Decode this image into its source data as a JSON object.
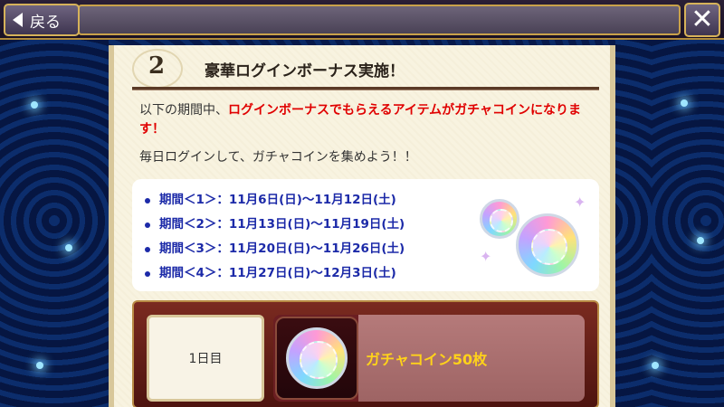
{
  "topbar": {
    "back_label": "戻る",
    "close_label": "✕"
  },
  "section": {
    "number": "2",
    "title": "豪華ログインボーナス実施！"
  },
  "intro": {
    "prefix": "以下の期間中、",
    "highlight": "ログインボーナスでもらえるアイテムがガチャコインになります！"
  },
  "daily_note": "毎日ログインして、ガチャコインを集めよう！！",
  "periods": [
    "期間＜1＞：11月6日(日)～11月12日(土)",
    "期間＜2＞：11月13日(日)～11月19日(土)",
    "期間＜3＞：11月20日(日)～11月26日(土)",
    "期間＜4＞：11月27日(日)～12月3日(土)"
  ],
  "reward": {
    "day_label": "1日目",
    "item_name": "ガチャコイン50枚"
  },
  "colors": {
    "highlight_red": "#e00000",
    "period_blue": "#1c2aa8",
    "item_gold": "#ffd21a"
  }
}
